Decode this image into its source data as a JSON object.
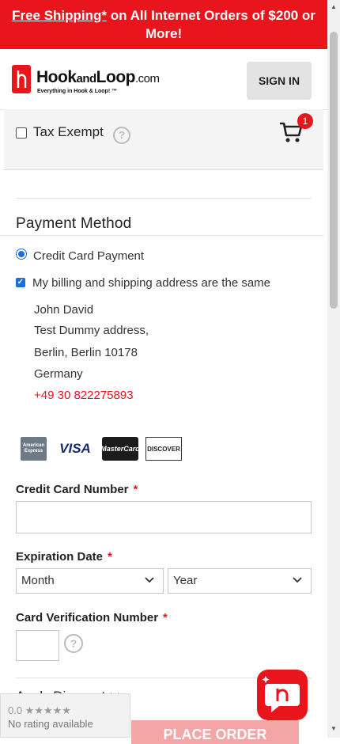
{
  "banner": {
    "link_text": "Free Shipping*",
    "rest_text": " on All Internet Orders of $200 or More!"
  },
  "header": {
    "logo_main": "Hook",
    "logo_small": "and",
    "logo_main2": "Loop",
    "logo_suffix": ".com",
    "logo_tagline": "Everything in Hook & Loop! ™",
    "signin_label": "SIGN IN",
    "cart_count": "1"
  },
  "tax": {
    "label": "Tax Exempt",
    "help": "?"
  },
  "payment": {
    "title": "Payment Method",
    "option_label": "Credit Card Payment",
    "same_address_label": "My billing and shipping address are the same",
    "address": {
      "name": "John David",
      "street": "Test Dummy address,",
      "city": "Berlin, Berlin 10178",
      "country": "Germany",
      "phone": "+49 30 822275893"
    },
    "cards": [
      "American Express",
      "VISA",
      "MasterCard",
      "DISCOVER"
    ]
  },
  "form": {
    "cc_number_label": "Credit Card Number",
    "required_mark": "*",
    "expiration_label": "Expiration Date",
    "month_value": "Month",
    "year_value": "Year",
    "cvv_label": "Card Verification Number",
    "cvv_help": "?"
  },
  "footer": {
    "comment_label": "Apply Discount",
    "rating_score": "0.0 ★★★★★",
    "rating_text": "No rating available",
    "place_order": "PLACE ORDER"
  },
  "colors": {
    "brand_red": "#e8151c",
    "accent_blue": "#1b6de0"
  }
}
